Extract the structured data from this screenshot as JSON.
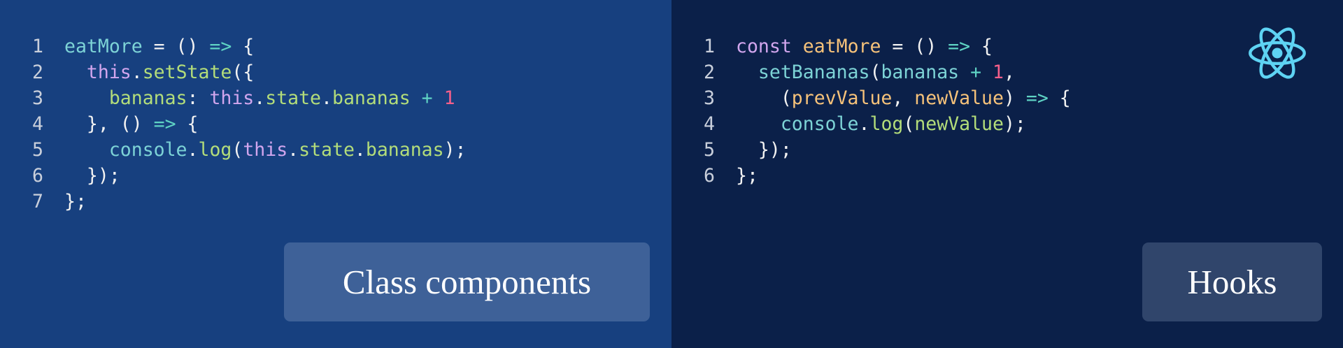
{
  "left_panel": {
    "label": "Class components",
    "lines": [
      {
        "n": "1",
        "tokens": [
          [
            "eatMore",
            "t-func"
          ],
          [
            " = () ",
            "t-plain"
          ],
          [
            "=>",
            "t-arrow"
          ],
          [
            " {",
            "t-plain"
          ]
        ]
      },
      {
        "n": "2",
        "tokens": [
          [
            "  ",
            "t-plain"
          ],
          [
            "this",
            "t-keyword"
          ],
          [
            ".",
            "t-plain"
          ],
          [
            "setState",
            "t-prop"
          ],
          [
            "({",
            "t-plain"
          ]
        ]
      },
      {
        "n": "3",
        "tokens": [
          [
            "    ",
            "t-plain"
          ],
          [
            "bananas",
            "t-prop"
          ],
          [
            ": ",
            "t-plain"
          ],
          [
            "this",
            "t-keyword"
          ],
          [
            ".",
            "t-plain"
          ],
          [
            "state",
            "t-prop"
          ],
          [
            ".",
            "t-plain"
          ],
          [
            "bananas",
            "t-prop"
          ],
          [
            " ",
            "t-plain"
          ],
          [
            "+",
            "t-arrow"
          ],
          [
            " ",
            "t-plain"
          ],
          [
            "1",
            "t-number"
          ]
        ]
      },
      {
        "n": "4",
        "tokens": [
          [
            "  }, () ",
            "t-plain"
          ],
          [
            "=>",
            "t-arrow"
          ],
          [
            " {",
            "t-plain"
          ]
        ]
      },
      {
        "n": "5",
        "tokens": [
          [
            "    ",
            "t-plain"
          ],
          [
            "console",
            "t-func"
          ],
          [
            ".",
            "t-plain"
          ],
          [
            "log",
            "t-prop"
          ],
          [
            "(",
            "t-plain"
          ],
          [
            "this",
            "t-keyword"
          ],
          [
            ".",
            "t-plain"
          ],
          [
            "state",
            "t-prop"
          ],
          [
            ".",
            "t-plain"
          ],
          [
            "bananas",
            "t-prop"
          ],
          [
            ");",
            "t-plain"
          ]
        ]
      },
      {
        "n": "6",
        "tokens": [
          [
            "  });",
            "t-plain"
          ]
        ]
      },
      {
        "n": "7",
        "tokens": [
          [
            "};",
            "t-plain"
          ]
        ]
      }
    ]
  },
  "right_panel": {
    "label": "Hooks",
    "logo_icon": "react-logo-icon",
    "lines": [
      {
        "n": "1",
        "tokens": [
          [
            "const",
            "t-keyword"
          ],
          [
            " ",
            "t-plain"
          ],
          [
            "eatMore",
            "t-decl"
          ],
          [
            " = () ",
            "t-plain"
          ],
          [
            "=>",
            "t-arrow"
          ],
          [
            " {",
            "t-plain"
          ]
        ]
      },
      {
        "n": "2",
        "tokens": [
          [
            "  ",
            "t-plain"
          ],
          [
            "setBananas",
            "t-func"
          ],
          [
            "(",
            "t-plain"
          ],
          [
            "bananas",
            "t-func"
          ],
          [
            " ",
            "t-plain"
          ],
          [
            "+",
            "t-arrow"
          ],
          [
            " ",
            "t-plain"
          ],
          [
            "1",
            "t-number"
          ],
          [
            ",",
            "t-plain"
          ]
        ]
      },
      {
        "n": "3",
        "tokens": [
          [
            "    (",
            "t-plain"
          ],
          [
            "prevValue",
            "t-param"
          ],
          [
            ", ",
            "t-plain"
          ],
          [
            "newValue",
            "t-param"
          ],
          [
            ") ",
            "t-plain"
          ],
          [
            "=>",
            "t-arrow"
          ],
          [
            " {",
            "t-plain"
          ]
        ]
      },
      {
        "n": "4",
        "tokens": [
          [
            "    ",
            "t-plain"
          ],
          [
            "console",
            "t-func"
          ],
          [
            ".",
            "t-plain"
          ],
          [
            "log",
            "t-prop"
          ],
          [
            "(",
            "t-plain"
          ],
          [
            "newValue",
            "t-prop"
          ],
          [
            ");",
            "t-plain"
          ]
        ]
      },
      {
        "n": "5",
        "tokens": [
          [
            "  });",
            "t-plain"
          ]
        ]
      },
      {
        "n": "6",
        "tokens": [
          [
            "};",
            "t-plain"
          ]
        ]
      }
    ]
  },
  "colors": {
    "left_bg": "#17407f",
    "right_bg": "#0b2049",
    "react_logo": "#5ed3f3"
  }
}
